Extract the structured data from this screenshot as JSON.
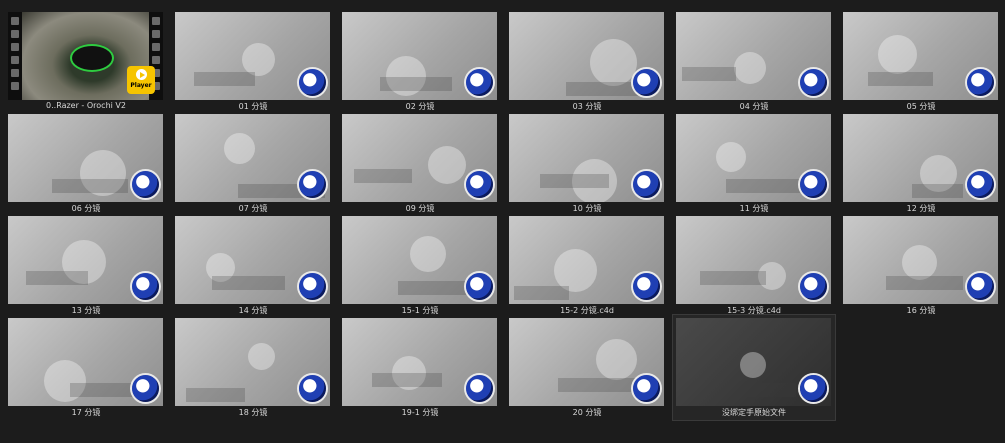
{
  "items": [
    {
      "label": "0..Razer - Orochi V2",
      "kind": "video",
      "badge": "Player"
    },
    {
      "label": "01 分镜",
      "kind": "c4d"
    },
    {
      "label": "02 分镜",
      "kind": "c4d"
    },
    {
      "label": "03 分镜",
      "kind": "c4d"
    },
    {
      "label": "04 分镜",
      "kind": "c4d"
    },
    {
      "label": "05 分镜",
      "kind": "c4d"
    },
    {
      "label": "06 分镜",
      "kind": "c4d"
    },
    {
      "label": "07 分镜",
      "kind": "c4d"
    },
    {
      "label": "09 分镜",
      "kind": "c4d"
    },
    {
      "label": "10 分镜",
      "kind": "c4d"
    },
    {
      "label": "11 分镜",
      "kind": "c4d"
    },
    {
      "label": "12 分镜",
      "kind": "c4d"
    },
    {
      "label": "13 分镜",
      "kind": "c4d"
    },
    {
      "label": "14 分镜",
      "kind": "c4d"
    },
    {
      "label": "15-1 分镜",
      "kind": "c4d"
    },
    {
      "label": "15-2 分镜.c4d",
      "kind": "c4d"
    },
    {
      "label": "15-3 分镜.c4d",
      "kind": "c4d"
    },
    {
      "label": "16 分镜",
      "kind": "c4d"
    },
    {
      "label": "17 分镜",
      "kind": "c4d"
    },
    {
      "label": "18 分镜",
      "kind": "c4d"
    },
    {
      "label": "19-1 分镜",
      "kind": "c4d"
    },
    {
      "label": "20 分镜",
      "kind": "c4d"
    },
    {
      "label": "没绑定手原始文件",
      "kind": "c4d-dark"
    }
  ],
  "colors": {
    "background": "#1c1c1c",
    "label": "#d8d8d8",
    "player_badge": "#f6c400",
    "c4d_blue": "#1f3fb3"
  }
}
